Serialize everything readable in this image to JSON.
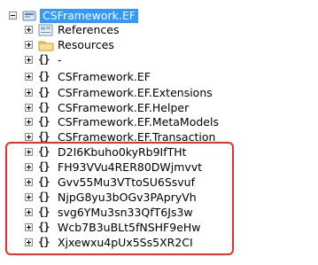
{
  "tree": {
    "project": {
      "label": "CSFramework.EF"
    },
    "items": [
      {
        "label": "References",
        "icon": "references-icon"
      },
      {
        "label": "Resources",
        "icon": "folder-icon"
      },
      {
        "label": "-",
        "icon": "namespace-icon"
      },
      {
        "label": "CSFramework.EF",
        "icon": "namespace-icon"
      },
      {
        "label": "CSFramework.EF.Extensions",
        "icon": "namespace-icon"
      },
      {
        "label": "CSFramework.EF.Helper",
        "icon": "namespace-icon"
      },
      {
        "label": "CSFramework.EF.MetaModels",
        "icon": "namespace-icon"
      },
      {
        "label": "CSFramework.EF.Transaction",
        "icon": "namespace-icon"
      },
      {
        "label": "D2I6Kbuho0kyRb9IfTHt",
        "icon": "namespace-icon"
      },
      {
        "label": "FH93VVu4RER80DWjmvvt",
        "icon": "namespace-icon"
      },
      {
        "label": "Gvv55Mu3VTtoSU6Ssvuf",
        "icon": "namespace-icon"
      },
      {
        "label": "NjpG8yu3bOGv3PApryVh",
        "icon": "namespace-icon"
      },
      {
        "label": "svg6YMu3sn33QfT6Js3w",
        "icon": "namespace-icon"
      },
      {
        "label": "Wcb7B3uBLt5fNSHF9eHw",
        "icon": "namespace-icon"
      },
      {
        "label": "Xjxewxu4pUx5Ss5XR2CI",
        "icon": "namespace-icon"
      }
    ],
    "namespace_glyph": "{}"
  },
  "colors": {
    "selection": "#3399ff",
    "highlight_border": "#e8302a"
  }
}
